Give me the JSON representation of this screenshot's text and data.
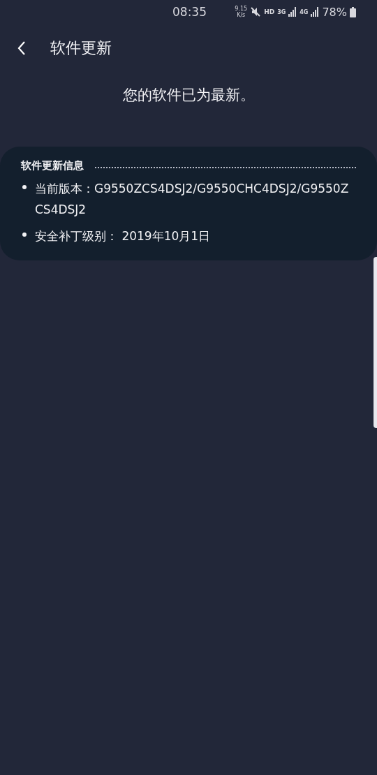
{
  "status_bar": {
    "time": "08:35",
    "speed_value": "9.15",
    "speed_unit": "K/s",
    "hd": "HD",
    "network_1": "3G",
    "network_2": "4G",
    "battery": "78%"
  },
  "header": {
    "title": "软件更新"
  },
  "message": "您的软件已为最新。",
  "info_card": {
    "title": "软件更新信息",
    "items": [
      "当前版本：G9550ZCS4DSJ2/G9550CHC4DSJ2/G9550ZCS4DSJ2",
      "安全补丁级别： 2019年10月1日"
    ]
  }
}
